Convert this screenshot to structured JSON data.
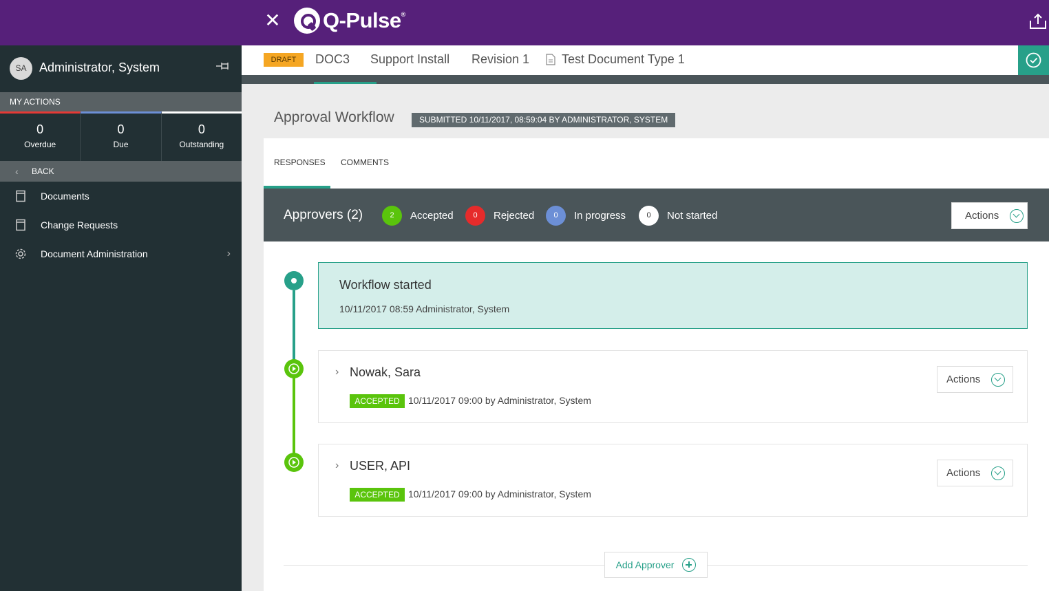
{
  "app": {
    "name": "Q-Pulse",
    "trademark": "®"
  },
  "user": {
    "initials": "SA",
    "name": "Administrator, System"
  },
  "sidebar": {
    "my_actions_label": "MY ACTIONS",
    "counts": [
      {
        "value": "0",
        "label": "Overdue",
        "color": "#e53935"
      },
      {
        "value": "0",
        "label": "Due",
        "color": "#6c8fd6"
      },
      {
        "value": "0",
        "label": "Outstanding",
        "color": "#ffffff"
      }
    ],
    "back_label": "BACK",
    "nav": [
      {
        "label": "Documents",
        "icon": "document-icon"
      },
      {
        "label": "Change Requests",
        "icon": "document-icon"
      },
      {
        "label": "Document Administration",
        "icon": "gear-icon"
      }
    ]
  },
  "doc": {
    "status": "DRAFT",
    "tabs": [
      "DOC3",
      "Support Install",
      "Revision 1",
      "Test Document Type 1"
    ]
  },
  "workflow": {
    "title": "Approval Workflow",
    "submitted": "SUBMITTED 10/11/2017, 08:59:04 BY ADMINISTRATOR, SYSTEM",
    "tabs": [
      "RESPONSES",
      "COMMENTS"
    ],
    "approvers_title": "Approvers (2)",
    "stats": [
      {
        "count": "2",
        "label": "Accepted",
        "color": "#5ac40c"
      },
      {
        "count": "0",
        "label": "Rejected",
        "color": "#e62b2b"
      },
      {
        "count": "0",
        "label": "In progress",
        "color": "#6c8fd6"
      },
      {
        "count": "0",
        "label": "Not started",
        "color": "#ffffff"
      }
    ],
    "actions_label": "Actions",
    "started": {
      "title": "Workflow started",
      "meta": "10/11/2017 08:59 Administrator, System"
    },
    "approvers": [
      {
        "name": "Nowak, Sara",
        "status": "ACCEPTED",
        "meta": "10/11/2017 09:00 by Administrator, System",
        "actions_label": "Actions"
      },
      {
        "name": "USER, API",
        "status": "ACCEPTED",
        "meta": "10/11/2017 09:00 by Administrator, System",
        "actions_label": "Actions"
      }
    ],
    "add_approver_label": "Add Approver"
  },
  "colors": {
    "brand": "#56207a",
    "accent": "#27a089",
    "sidebar": "#223034",
    "accepted": "#5ac40c"
  }
}
